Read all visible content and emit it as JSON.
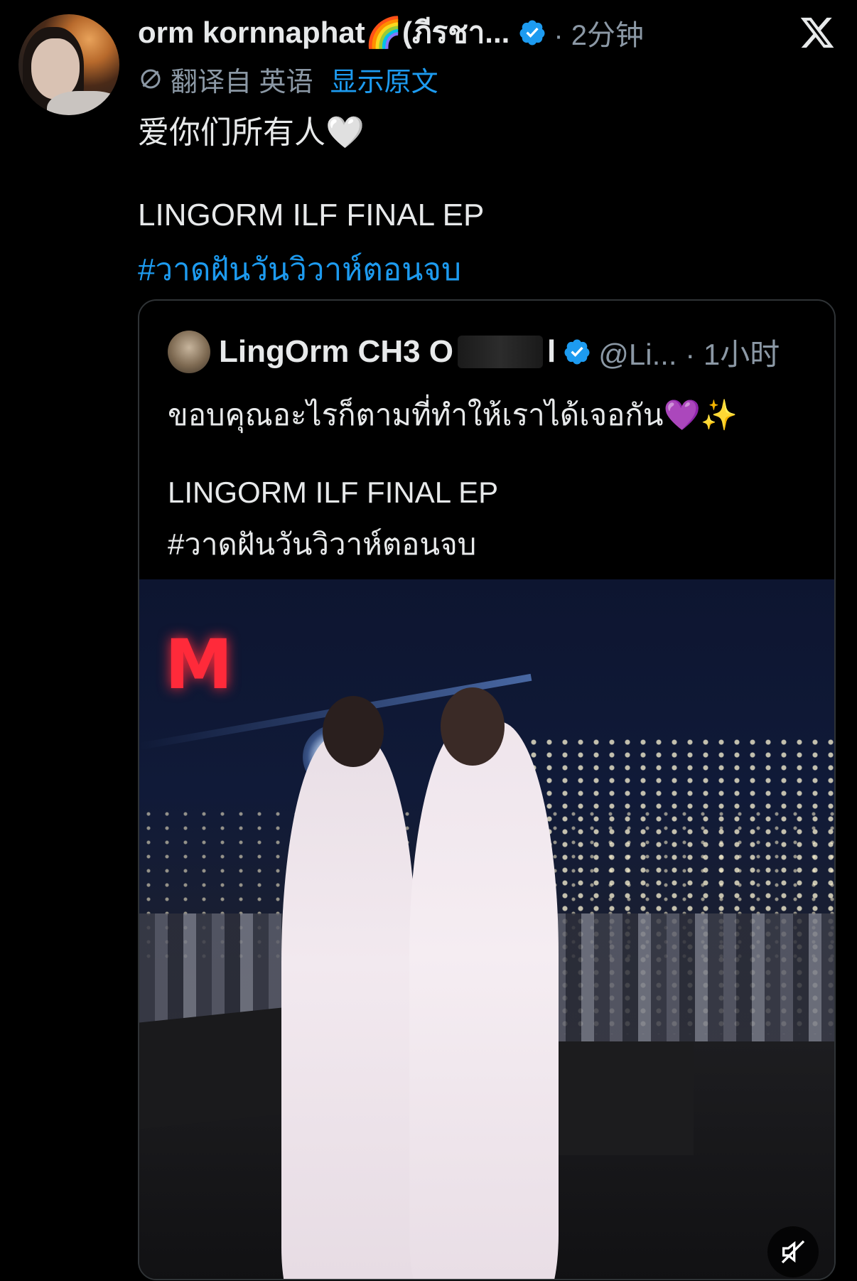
{
  "post": {
    "display_name": "orm kornnaphat🌈(ภีรชา...",
    "time": "· 2分钟",
    "translation": {
      "translated_from": "翻译自 英语",
      "show_original": "显示原文"
    },
    "text_line1": "爱你们所有人🤍",
    "text_line2": "LINGORM ILF FINAL EP",
    "hashtag": "#วาดฝันวันวิวาห์ตอนจบ"
  },
  "quote": {
    "name_visible": "LingOrm CH3 O",
    "name_end": "l",
    "handle_time": "@Li... · 1小时",
    "text_line1": "ขอบคุณอะไรก็ตามที่ทำให้เราได้เจอกัน💜✨",
    "text_line2": "LINGORM ILF FINAL EP",
    "hashtag": "#วาดฝันวันวิวาห์ตอนจบ",
    "media_sign": "M"
  },
  "icons": {
    "verified": "verified-badge-icon",
    "translate": "translate-icon",
    "close": "x-logo-icon",
    "mute": "muted-speaker-icon"
  },
  "colors": {
    "background": "#000000",
    "text": "#e7e9ea",
    "secondary": "#8b98a5",
    "link": "#1d9bf0",
    "border": "#2f3336"
  }
}
